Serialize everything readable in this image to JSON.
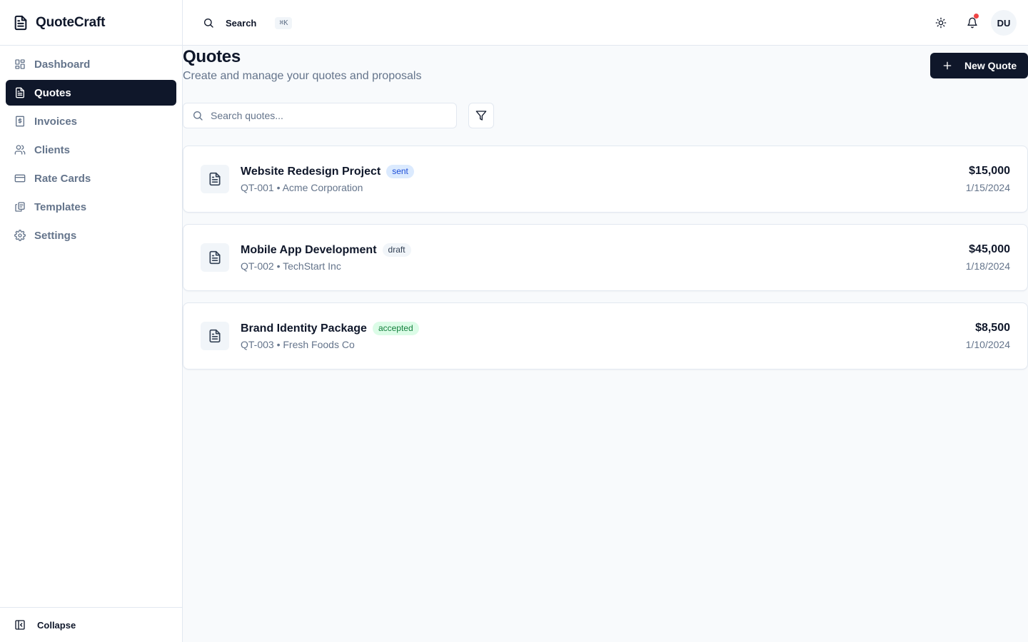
{
  "app": {
    "name": "QuoteCraft"
  },
  "sidebar": {
    "items": [
      {
        "label": "Dashboard",
        "icon": "layout-dashboard-icon",
        "active": false
      },
      {
        "label": "Quotes",
        "icon": "file-text-icon",
        "active": true
      },
      {
        "label": "Invoices",
        "icon": "receipt-icon",
        "active": false
      },
      {
        "label": "Clients",
        "icon": "users-icon",
        "active": false
      },
      {
        "label": "Rate Cards",
        "icon": "credit-card-icon",
        "active": false
      },
      {
        "label": "Templates",
        "icon": "copy-icon",
        "active": false
      },
      {
        "label": "Settings",
        "icon": "gear-icon",
        "active": false
      }
    ],
    "collapse_label": "Collapse"
  },
  "header": {
    "search_label": "Search",
    "search_shortcut": "⌘K",
    "avatar_initials": "DU",
    "has_notification": true
  },
  "page": {
    "title": "Quotes",
    "subtitle": "Create and manage your quotes and proposals",
    "new_button_label": "New Quote",
    "search_placeholder": "Search quotes..."
  },
  "quotes": [
    {
      "title": "Website Redesign Project",
      "status": "sent",
      "meta": "QT-001 • Acme Corporation",
      "amount": "$15,000",
      "date": "1/15/2024"
    },
    {
      "title": "Mobile App Development",
      "status": "draft",
      "meta": "QT-002 • TechStart Inc",
      "amount": "$45,000",
      "date": "1/18/2024"
    },
    {
      "title": "Brand Identity Package",
      "status": "accepted",
      "meta": "QT-003 • Fresh Foods Co",
      "amount": "$8,500",
      "date": "1/10/2024"
    }
  ],
  "colors": {
    "primary": "#0f172a",
    "muted_text": "#64748b",
    "border": "#e2e8f0",
    "background": "#f8fafc",
    "notification": "#ef4444",
    "status_sent": "#1d4ed8",
    "status_draft": "#334155",
    "status_accepted": "#15803d"
  }
}
